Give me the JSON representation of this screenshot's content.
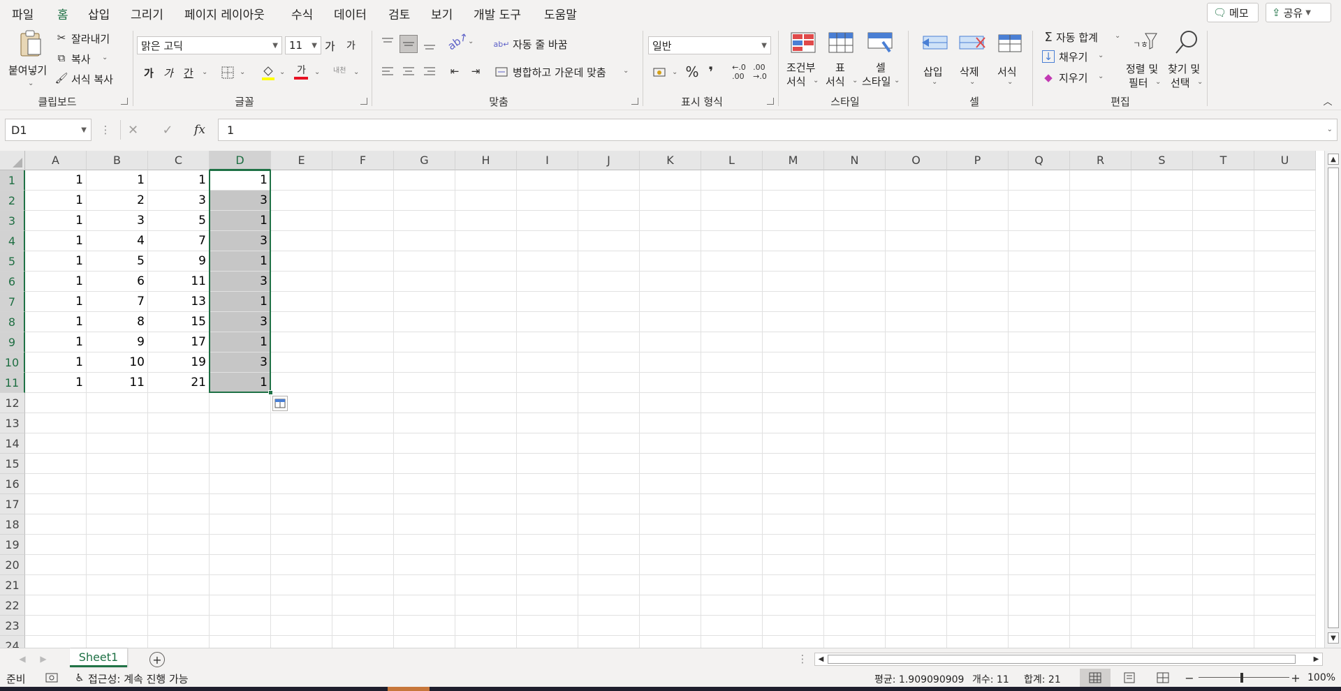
{
  "menu": {
    "tabs": [
      "파일",
      "홈",
      "삽입",
      "그리기",
      "페이지 레이아웃",
      "수식",
      "데이터",
      "검토",
      "보기",
      "개발 도구",
      "도움말"
    ],
    "memo": "메모",
    "share": "공유"
  },
  "ribbon": {
    "clipboard": {
      "label": "클립보드",
      "paste": "붙여넣기",
      "cut": "잘라내기",
      "copy": "복사",
      "format_painter": "서식 복사"
    },
    "font": {
      "label": "글꼴",
      "family": "맑은 고딕",
      "size": "11",
      "grow": "가",
      "shrink": "가",
      "bold": "가",
      "italic": "가",
      "underline": "간",
      "phonetic": "내천"
    },
    "alignment": {
      "label": "맞춤",
      "wrap": "자동 줄 바꿈",
      "merge": "병합하고 가운데 맞춤"
    },
    "number": {
      "label": "표시 형식",
      "format": "일반"
    },
    "styles": {
      "label": "스타일",
      "conditional_1": "조건부",
      "conditional_2": "서식",
      "table_1": "표",
      "table_2": "서식",
      "cell_1": "셀",
      "cell_2": "스타일"
    },
    "cells": {
      "label": "셀",
      "insert": "삽입",
      "delete": "삭제",
      "format": "서식"
    },
    "editing": {
      "label": "편집",
      "autosum": "자동 합계",
      "fill": "채우기",
      "clear": "지우기",
      "sort_1": "정렬 및",
      "sort_2": "필터",
      "find_1": "찾기 및",
      "find_2": "선택"
    }
  },
  "formula_bar": {
    "name_box": "D1",
    "formula": "1"
  },
  "sheet": {
    "columns": [
      "A",
      "B",
      "C",
      "D",
      "E",
      "F",
      "G",
      "H",
      "I",
      "J",
      "K",
      "L",
      "M",
      "N",
      "O",
      "P",
      "Q",
      "R",
      "S",
      "T",
      "U"
    ],
    "rows": [
      "1",
      "2",
      "3",
      "4",
      "5",
      "6",
      "7",
      "8",
      "9",
      "10",
      "11",
      "12",
      "13",
      "14",
      "15",
      "16",
      "17",
      "18",
      "19",
      "20",
      "21",
      "22",
      "23",
      "24"
    ],
    "cells": [
      [
        "1",
        "1",
        "1",
        "1"
      ],
      [
        "1",
        "2",
        "3",
        "3"
      ],
      [
        "1",
        "3",
        "5",
        "1"
      ],
      [
        "1",
        "4",
        "7",
        "3"
      ],
      [
        "1",
        "5",
        "9",
        "1"
      ],
      [
        "1",
        "6",
        "11",
        "3"
      ],
      [
        "1",
        "7",
        "13",
        "1"
      ],
      [
        "1",
        "8",
        "15",
        "3"
      ],
      [
        "1",
        "9",
        "17",
        "1"
      ],
      [
        "1",
        "10",
        "19",
        "3"
      ],
      [
        "1",
        "11",
        "21",
        "1"
      ]
    ],
    "tab_name": "Sheet1"
  },
  "status": {
    "ready": "준비",
    "accessibility": "접근성: 계속 진행 가능",
    "average": "평균: 1.909090909",
    "count": "개수: 11",
    "sum": "합계: 21",
    "zoom": "100%"
  },
  "colors": {
    "accent": "#217346",
    "selection_fill": "#c6c6c6"
  }
}
